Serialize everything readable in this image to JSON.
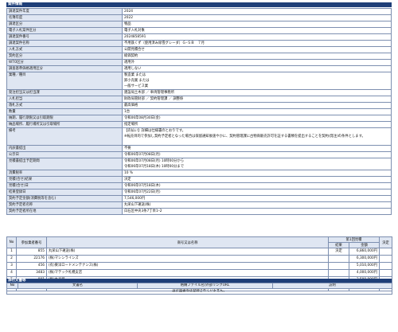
{
  "section1": {
    "title": "案件情報"
  },
  "info_rows": [
    {
      "k": "調達案件年度",
      "v": [
        "2024"
      ]
    },
    {
      "k": "名簿年度",
      "v": [
        "2022"
      ]
    },
    {
      "k": "調達区分",
      "v": [
        "物品"
      ]
    },
    {
      "k": "電子入札案件区分",
      "v": [
        "電子入札対象"
      ]
    },
    {
      "k": "調達案件番号",
      "v": [
        "2024858591"
      ]
    },
    {
      "k": "調達案件名称",
      "v": [
        "不用鉄くず（使用済み除雪グレーダ）ＧｰＳＢ　７月"
      ]
    },
    {
      "k": "入札方式",
      "v": [
        "公開見積合せ"
      ]
    },
    {
      "k": "契約区分",
      "v": [
        "総価契約"
      ]
    },
    {
      "k": "WTO区分",
      "v": [
        "適用外"
      ]
    },
    {
      "k": "調査基準価格適用区分",
      "v": [
        "適用しない"
      ]
    },
    {
      "k": "業種／種目",
      "v": [
        "製造業 または",
        "卸小売業 または",
        "一般サービス業"
      ]
    },
    {
      "k": "発注担当又は担当課",
      "v": [
        "建設局土木部 ／ 車両管理事務所"
      ]
    },
    {
      "k": "入札担当",
      "v": [
        "財政局管財部 ／ 契約管理課 ／ 調整係"
      ]
    },
    {
      "k": "落札方式",
      "v": [
        "最高価格"
      ]
    },
    {
      "k": "数量",
      "v": [
        "1台"
      ]
    },
    {
      "k": "納期、履行期限又は引取期限",
      "v": [
        "令和06年08月30日(金)"
      ]
    },
    {
      "k": "納品場所、履行場所又は引取場所",
      "v": [
        "指定場所"
      ]
    },
    {
      "k": "備考",
      "v": [
        "【売払い】詳細は仕様書のとおりです。",
        "※転売目的で参加し契約予定者となった場合は保留通知後速やかに、契約管理課に古物商販売許可を証する書類を提出することを契約(発注)の条件とします。",
        ""
      ]
    },
    {
      "k": "内訳書提出",
      "v": [
        "不要"
      ]
    },
    {
      "k": "公示日",
      "v": [
        "令和06年07月08日(月)"
      ]
    },
    {
      "k": "見積書提出予定期間",
      "v": [
        "令和06年07月08日(月) 10時00分から",
        "令和06年07月18日(木) 10時00分まで"
      ]
    },
    {
      "k": "消費税率",
      "v": [
        "10 %"
      ]
    },
    {
      "k": "見積(合せ)結果",
      "v": [
        "決定"
      ]
    },
    {
      "k": "見積(合せ)日",
      "v": [
        "令和06年07月18日(木)"
      ]
    },
    {
      "k": "結果登録日",
      "v": [
        "令和06年07月22日(月)"
      ]
    },
    {
      "k": "契約予定金額(消費税等を含む)",
      "v": [
        "7,546,000円"
      ]
    },
    {
      "k": "契約予定者名称",
      "v": [
        "丸栄山下運送(株)"
      ]
    },
    {
      "k": "契約予定者所在地",
      "v": [
        "白石区中央3条7丁目1ｰ2"
      ]
    }
  ],
  "bids": {
    "headers": {
      "no": "No",
      "code": "参加業者番号",
      "name": "商号又は名称",
      "round": "第1回見積",
      "result": "結果",
      "amount": "金額",
      "decision": "決定"
    },
    "rows": [
      {
        "no": "1",
        "code": "855",
        "name": "丸栄山下運送(株)",
        "result": "決定",
        "amount": "6,860,000円"
      },
      {
        "no": "2",
        "code": "22176",
        "name": "(株)マシンラインズ",
        "result": "",
        "amount": "6,300,000円"
      },
      {
        "no": "3",
        "code": "456",
        "name": "(有)東洋ロードメンテナンス(株)",
        "result": "",
        "amount": "5,010,000円"
      },
      {
        "no": "4",
        "code": "3483",
        "name": "(株)マテック札幌支店",
        "result": "",
        "amount": "4,000,000円"
      },
      {
        "no": "5",
        "code": "901",
        "name": "(株)水谷組",
        "result": "",
        "amount": "3,500,000円"
      },
      {
        "no": "6",
        "code": "7430",
        "name": "(有)佐々木商会",
        "result": "無効",
        "amount": ""
      }
    ]
  },
  "section2": {
    "title": "添付文書等"
  },
  "docs": {
    "headers": {
      "no": "No",
      "name": "文書名",
      "file": "格納ファイル名/外部リンクURL",
      "desc": "説明"
    },
    "empty": "設計図書等は登録されていません。"
  }
}
